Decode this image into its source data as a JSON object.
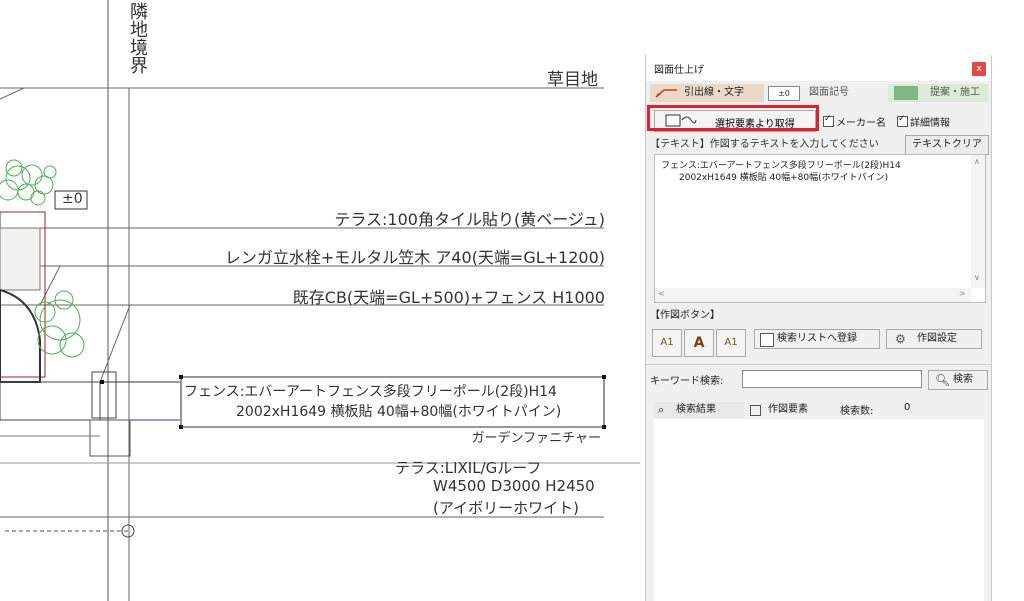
{
  "cad": {
    "boundary_label": "隣地境界",
    "labels": {
      "grass": "草目地",
      "terrace_tile": "テラス:100角タイル貼り(黄ベージュ)",
      "brick": "レンガ立水栓+モルタル笠木 ア40(天端=GL+1200)",
      "existing_cb": "既存CB(天端=GL+500)+フェンス H1000",
      "fence_line1": "フェンス:エバーアートフェンス多段フリーポール(2段)H14",
      "fence_line2": "2002xH1649 横板貼 40幅+80幅(ホワイトパイン)",
      "garden_furniture": "ガーデンファニチャー",
      "terrace_roof_line1": "テラス:LIXIL/Gルーフ",
      "terrace_roof_line2": "W4500 D3000 H2450",
      "terrace_roof_line3": "(アイボリーホワイト)",
      "level": "±0"
    }
  },
  "panel": {
    "title": "図面仕上げ",
    "close": "x",
    "tabs": {
      "leader_icon": "A1",
      "leader": "引出線・文字",
      "symbol_box": "±0",
      "symbol": "図面記号",
      "proposal": "提案・施工"
    },
    "select_button": "選択要素より取得",
    "check_maker": "メーカー名",
    "check_detail": "詳細情報",
    "prompt": "【テキスト】作図するテキストを入力してください",
    "text_clear": "テキストクリア",
    "text_area": {
      "line1": "フェンス:エバーアートフェンス多段フリーポール(2段)H14",
      "line2": "2002xH1649 横板貼 40幅+80幅(ホワイトパイン)"
    },
    "section_buttons": "【作図ボタン】",
    "btn_leader": "A1",
    "btn_text": "A",
    "btn_leader_box": "A1",
    "register": "検索リストへ登録",
    "settings": "作図設定",
    "keyword_label": "キーワード検索:",
    "keyword_value": "",
    "search": "検索",
    "result_tab": "検索結果",
    "elements_tab": "作図要素",
    "count_label": "検索数:",
    "count_value": "0"
  }
}
